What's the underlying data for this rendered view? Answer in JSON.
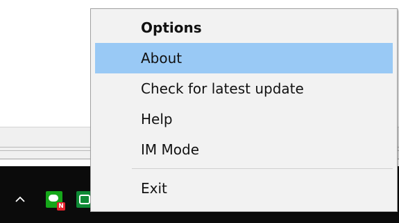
{
  "context_menu": {
    "items": [
      {
        "label": "Options",
        "bold": true,
        "highlighted": false
      },
      {
        "label": "About",
        "bold": false,
        "highlighted": true
      },
      {
        "label": "Check for latest update",
        "bold": false,
        "highlighted": false
      },
      {
        "label": "Help",
        "bold": false,
        "highlighted": false
      },
      {
        "label": "IM Mode",
        "bold": false,
        "highlighted": false
      },
      {
        "label": "Exit",
        "bold": false,
        "highlighted": false
      }
    ],
    "highlight_color": "#99c9f5",
    "background_color": "#f2f2f2"
  },
  "taskbar": {
    "background_color": "#0b0b0b",
    "tray_icons": [
      {
        "icon": "chevron-up-icon"
      },
      {
        "icon": "chat-notification-icon",
        "badge": "N"
      },
      {
        "icon": "phone-app-icon"
      }
    ]
  }
}
